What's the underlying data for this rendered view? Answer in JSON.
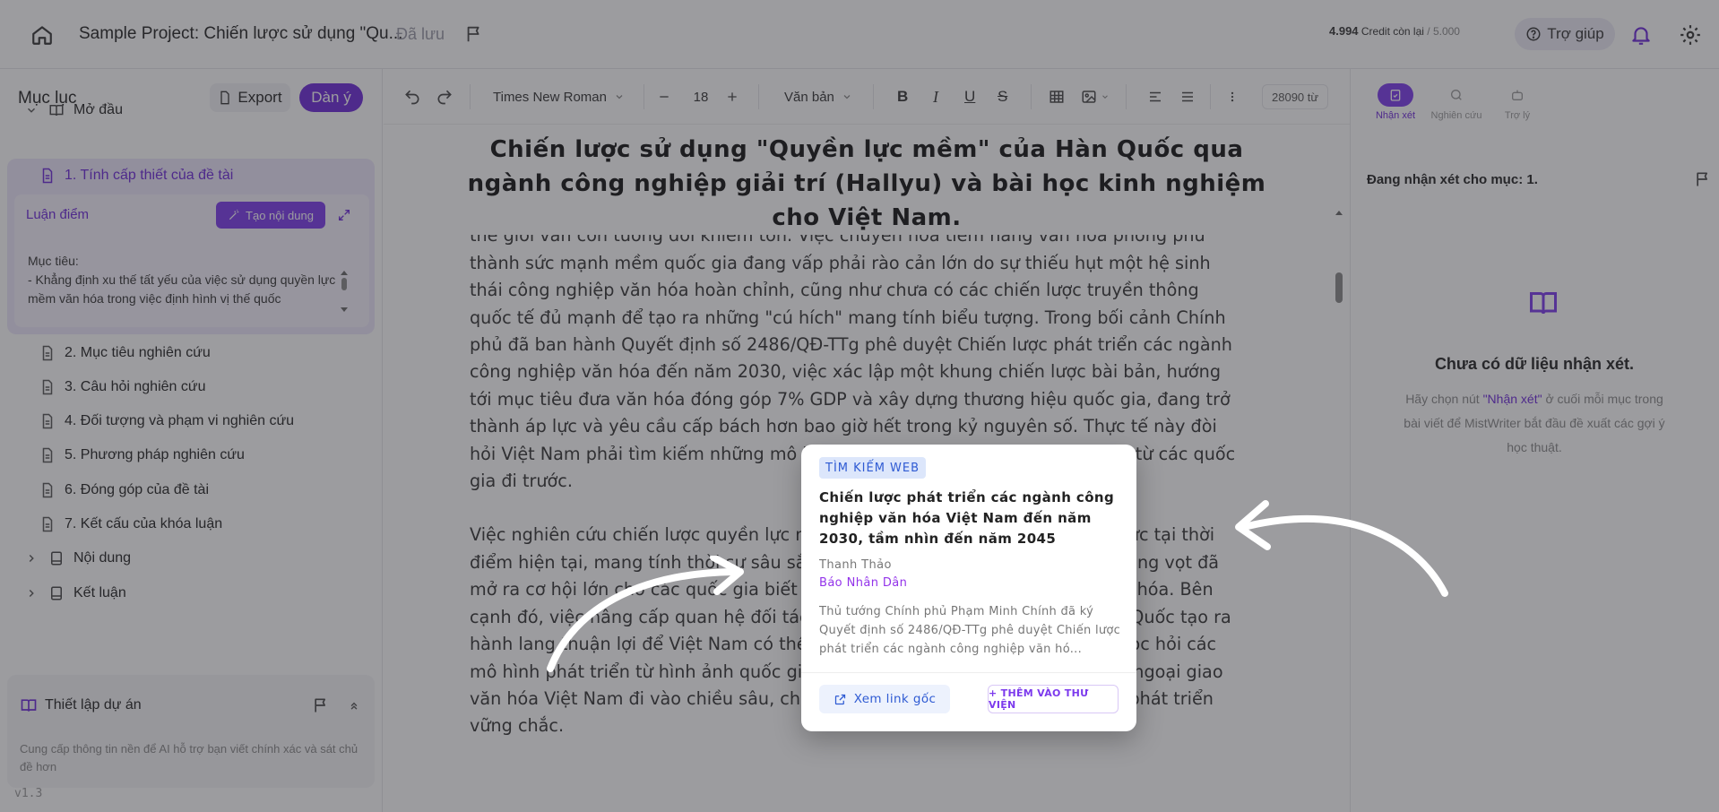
{
  "topbar": {
    "project_title": "Sample Project: Chiến lược sử dụng \"Qu...",
    "saved_status": "Đã lưu",
    "credit_value": "4.994",
    "credit_label": "Credit còn lại",
    "credit_sep": "/",
    "credit_total": "5.000",
    "help_label": "Trợ giúp"
  },
  "sidebar": {
    "title": "Mục lục",
    "export_label": "Export",
    "outline_label": "Dàn ý",
    "section_intro": "Mở đầu",
    "active_item": "1. Tính cấp thiết của đề tài",
    "luan_diem_label": "Luận điểm",
    "create_content_label": "Tạo nội dung",
    "muc_tieu_title": "Mục tiêu:",
    "muc_tieu_text": "- Khẳng định xu thế tất yếu của việc sử dụng quyền lực mềm văn hóa trong việc định hình vị thế quốc",
    "items": [
      "2. Mục tiêu nghiên cứu",
      "3. Câu hỏi nghiên cứu",
      "4. Đối tượng và phạm vi nghiên cứu",
      "5. Phương pháp nghiên cứu",
      "6. Đóng góp của đề tài",
      "7. Kết cấu của khóa luận"
    ],
    "section_content": "Nội dung",
    "section_conclusion": "Kết luận",
    "setup_title": "Thiết lập dự án",
    "setup_desc": "Cung cấp thông tin nền để AI hỗ trợ bạn viết chính xác và sát chủ đề hơn",
    "version": "v1.3"
  },
  "toolbar": {
    "font_family": "Times New Roman",
    "font_size": "18",
    "style": "Văn bản",
    "word_count": "28090 từ"
  },
  "editor": {
    "title": "Chiến lược sử dụng \"Quyền lực mềm\" của Hàn Quốc qua ngành công nghiệp giải trí (Hallyu) và bài học kinh nghiệm cho Việt Nam.",
    "paragraph_1": "sự và nguồn lực sáng tạo trẻ dồi dào, sức ảnh hưởng của văn hóa Việt Nam trên bản đồ thế giới vẫn còn tương đối khiêm tốn. Việc chuyển hóa tiềm năng văn hóa phong phú thành sức mạnh mềm quốc gia đang vấp phải rào cản lớn do sự thiếu hụt một hệ sinh thái công nghiệp văn hóa hoàn chỉnh, cũng như chưa có các chiến lược truyền thông quốc tế đủ mạnh để tạo ra những \"cú hích\" mang tính biểu tượng. Trong bối cảnh Chính phủ đã ban hành Quyết định số 2486/QĐ-TTg phê duyệt Chiến lược phát triển các ngành công nghiệp văn hóa đến năm 2030, việc xác lập một khung chiến lược bài bản, hướng tới mục tiêu đưa văn hóa đóng góp 7% GDP và xây dựng thương hiệu quốc gia, đang trở thành áp lực và yêu cầu cấp bách hơn bao giờ hết trong kỷ nguyên số. Thực tế này đòi hỏi Việt Nam phải tìm kiếm những mô hình tham chiếu có tính ứng dụng cao từ các quốc gia đi trước.",
    "paragraph_2": "Việc nghiên cứu chiến lược quyền lực mềm của Hàn Quốc có ý nghĩa thiết thực tại thời điểm hiện tại, mang tính thời sự sâu sắc khi nhu cầu tiêu dùng nội dung số tăng vọt đã mở ra cơ hội lớn cho các quốc gia biết tận dụng công nghệ để phân phối văn hóa. Bên cạnh đó, việc nâng cấp quan hệ đối tác chiến lược toàn diện Việt Nam - Hàn Quốc tạo ra hành lang thuận lợi để Việt Nam có thể tiếp cận trực tiếp nguồn tri thức và học hỏi các mô hình phát triển từ hình ảnh quốc gia của Hàn Quốc được kỳ vọng sẽ giúp ngoại giao văn hóa Việt Nam đi vào chiều sâu, chuyển hóa ảnh hưởng thành nguồn lực phát triển vững chắc."
  },
  "right_panel": {
    "tabs": [
      "Nhận xét",
      "Nghiên cứu",
      "Trợ lý"
    ],
    "heading": "Đang nhận xét cho mục: 1.",
    "empty_title": "Chưa có dữ liệu nhận xét.",
    "hint_before": "Hãy chọn nút ",
    "hint_quote": "\"Nhận xét\"",
    "hint_after": " ở cuối mỗi mục trong bài viết để MistWriter bắt đầu đề xuất các gợi ý học thuật."
  },
  "popup": {
    "tag": "TÌM KIẾM WEB",
    "title": "Chiến lược phát triển các ngành công nghiệp văn hóa Việt Nam đến năm 2030, tầm nhìn đến năm 2045",
    "author": "Thanh Thảo",
    "source": "Báo Nhân Dân",
    "description": "Thủ tướng Chính phủ Phạm Minh Chính đã ký Quyết định số 2486/QĐ-TTg phê duyệt Chiến lược phát triển các ngành công nghiệp văn hó...",
    "view_link_label": "Xem link gốc",
    "add_library_label": "+ THÊM VÀO THƯ VIỆN"
  },
  "colors": {
    "accent": "#6d28d9",
    "overlay": "#2d2d34"
  }
}
